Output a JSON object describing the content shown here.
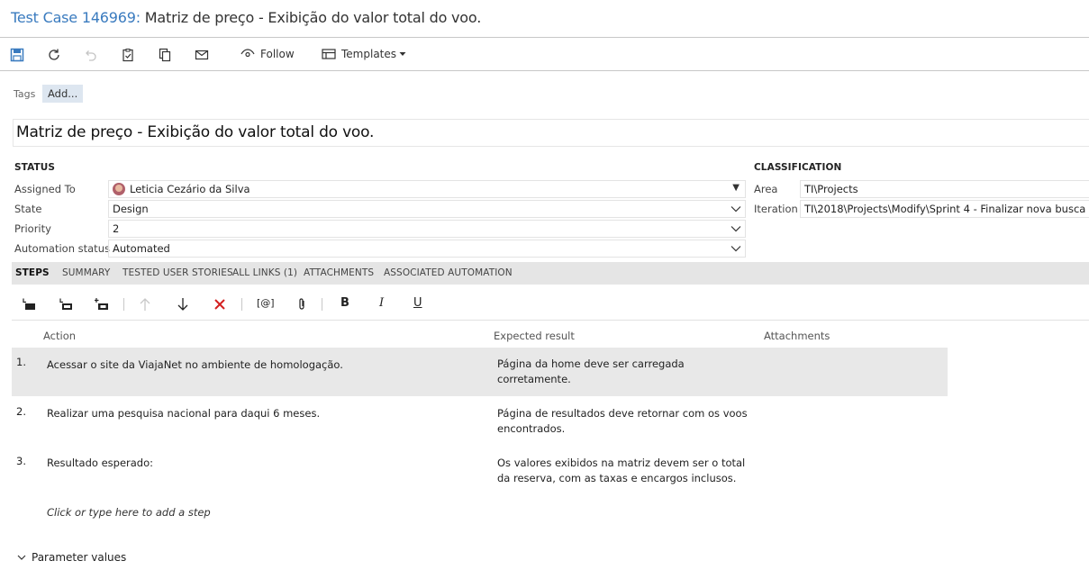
{
  "header": {
    "case_id": "Test Case 146969:",
    "title": "Matriz de preço - Exibição do valor total do voo."
  },
  "toolbar": {
    "follow_label": "Follow",
    "templates_label": "Templates",
    "icons": [
      "save-icon",
      "refresh-icon",
      "undo-icon",
      "clipboard-check-icon",
      "copy-icon",
      "mail-icon",
      "eye-icon",
      "template-icon",
      "caret-down-icon"
    ]
  },
  "tags": {
    "label": "Tags",
    "add_label": "Add..."
  },
  "title_field": {
    "value": "Matriz de preço - Exibição do valor total do voo."
  },
  "status": {
    "heading": "STATUS",
    "assigned_to": {
      "label": "Assigned To",
      "value": "Leticia Cezário da Silva"
    },
    "state": {
      "label": "State",
      "value": "Design"
    },
    "priority": {
      "label": "Priority",
      "value": "2"
    },
    "automation_status": {
      "label": "Automation status",
      "value": "Automated"
    }
  },
  "classification": {
    "heading": "CLASSIFICATION",
    "area": {
      "label": "Area",
      "value": "TI\\Projects"
    },
    "iteration": {
      "label": "Iteration",
      "value": "TI\\2018\\Projects\\Modify\\Sprint 4 - Finalizar nova busca"
    }
  },
  "tabs": [
    {
      "label": "STEPS",
      "active": true
    },
    {
      "label": "SUMMARY",
      "active": false
    },
    {
      "label": "TESTED USER STORIES",
      "active": false
    },
    {
      "label": "ALL LINKS (1)",
      "active": false
    },
    {
      "label": "ATTACHMENTS",
      "active": false
    },
    {
      "label": "ASSOCIATED AUTOMATION",
      "active": false
    }
  ],
  "steps_toolbar": {
    "param_label": "[@]",
    "bold_label": "B",
    "italic_label": "I",
    "underline_label": "U"
  },
  "steps_table": {
    "columns": [
      "Action",
      "Expected result",
      "Attachments"
    ],
    "rows": [
      {
        "num": "1.",
        "action": "Acessar o site da ViajaNet no ambiente de homologação.",
        "expected": "Página da home deve ser carregada corretamente.",
        "selected": true
      },
      {
        "num": "2.",
        "action": "Realizar uma pesquisa nacional para daqui 6 meses.",
        "expected": "Página de resultados deve retornar com os voos encontrados.",
        "selected": false
      },
      {
        "num": "3.",
        "action": "Resultado esperado:",
        "expected": "Os valores exibidos na matriz devem ser o total da reserva, com as taxas e encargos inclusos.",
        "selected": false
      }
    ],
    "add_step_placeholder": "Click or type here to add a step"
  },
  "parameter_values_label": "Parameter values"
}
